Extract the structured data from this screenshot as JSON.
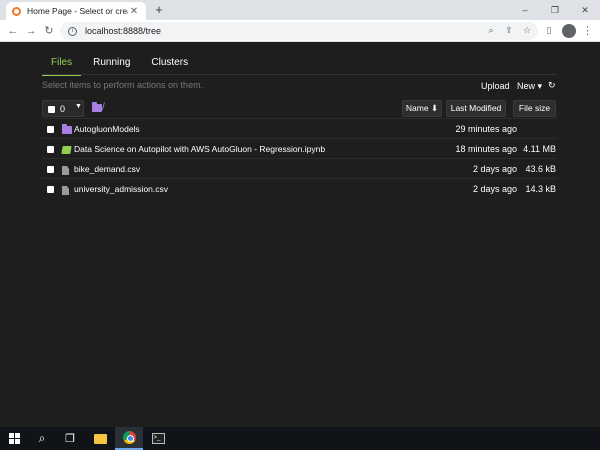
{
  "browser": {
    "tab_title": "Home Page - Select or create a n",
    "new_tab": "+",
    "url": "localhost:8888/tree",
    "window": {
      "minimize": "–",
      "restore": "❐",
      "close": "✕"
    }
  },
  "jupyter": {
    "tabs": [
      {
        "label": "Files",
        "active": true
      },
      {
        "label": "Running",
        "active": false
      },
      {
        "label": "Clusters",
        "active": false
      }
    ],
    "hint": "Select items to perform actions on them.",
    "upload_label": "Upload",
    "new_label": "New ▾",
    "refresh_icon": "↻",
    "selected_count": "0",
    "breadcrumb": "/",
    "sort": {
      "name": "Name ⬇",
      "last_modified": "Last Modified",
      "file_size": "File size"
    },
    "items": [
      {
        "type": "folder",
        "name": "AutogluonModels",
        "modified": "29 minutes ago",
        "size": ""
      },
      {
        "type": "notebook",
        "name": "Data Science on Autopilot with AWS AutoGluon - Regression.ipynb",
        "modified": "18 minutes ago",
        "size": "4.11 MB"
      },
      {
        "type": "file",
        "name": "bike_demand.csv",
        "modified": "2 days ago",
        "size": "43.6 kB"
      },
      {
        "type": "file",
        "name": "university_admission.csv",
        "modified": "2 days ago",
        "size": "14.3 kB"
      }
    ]
  },
  "taskbar": {
    "icons": [
      "windows-start-icon",
      "search-icon",
      "task-view-icon",
      "file-explorer-icon",
      "chrome-icon",
      "terminal-icon"
    ]
  }
}
